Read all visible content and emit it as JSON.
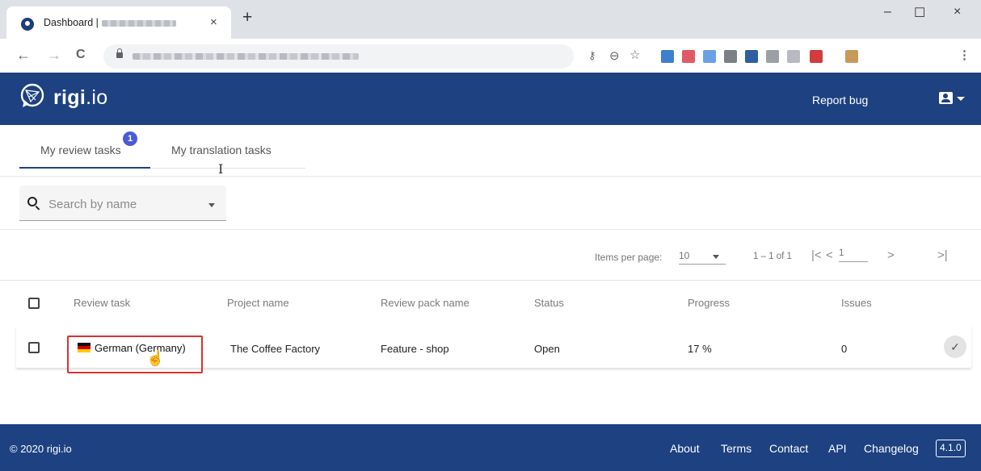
{
  "browser": {
    "tab_title": "Dashboard |",
    "tab_close": "×",
    "new_tab": "+",
    "window": {
      "minimize": "–",
      "maximize": "☐",
      "close": "×"
    },
    "nav": {
      "back": "←",
      "forward": "→",
      "reload": "C"
    },
    "omnibox_icons": {
      "key": "key-icon",
      "zoom": "zoom-icon",
      "star": "star-icon"
    },
    "extension_colors": [
      "#3f7fcf",
      "#e05a66",
      "#6aa0e6",
      "#7c7f86",
      "#2f5f9f",
      "#9aa0a6",
      "#b9b9c3",
      "#d23c3c",
      "#c79a5c"
    ]
  },
  "header": {
    "logo_bold": "rigi",
    "logo_rest": ".io",
    "report_bug": "Report bug",
    "account_icon": "account-box-icon",
    "brand_color": "#1d4181"
  },
  "tabs": {
    "items": [
      {
        "label": "My review tasks",
        "active": true,
        "badge": "1"
      },
      {
        "label": "My translation tasks",
        "active": false
      }
    ]
  },
  "search": {
    "placeholder": "Search by name",
    "value": ""
  },
  "paginator": {
    "items_per_page_label": "Items per page:",
    "items_per_page": "10",
    "range": "1 – 1 of 1",
    "page": "1",
    "first": "|<",
    "prev": "<",
    "next": ">",
    "last": ">|"
  },
  "table": {
    "columns": [
      "Review task",
      "Project name",
      "Review pack name",
      "Status",
      "Progress",
      "Issues"
    ],
    "rows": [
      {
        "review_task": "German (Germany)",
        "flag": "de",
        "project_name": "The Coffee Factory",
        "review_pack_name": "Feature - shop",
        "status": "Open",
        "progress": "17 %",
        "issues": "0",
        "action_icon": "check-icon"
      }
    ],
    "highlight_color": "#d83232"
  },
  "footer": {
    "copyright": "© 2020 rigi.io",
    "links": [
      "About",
      "Terms",
      "Contact",
      "API",
      "Changelog"
    ],
    "version": "4.1.0"
  }
}
